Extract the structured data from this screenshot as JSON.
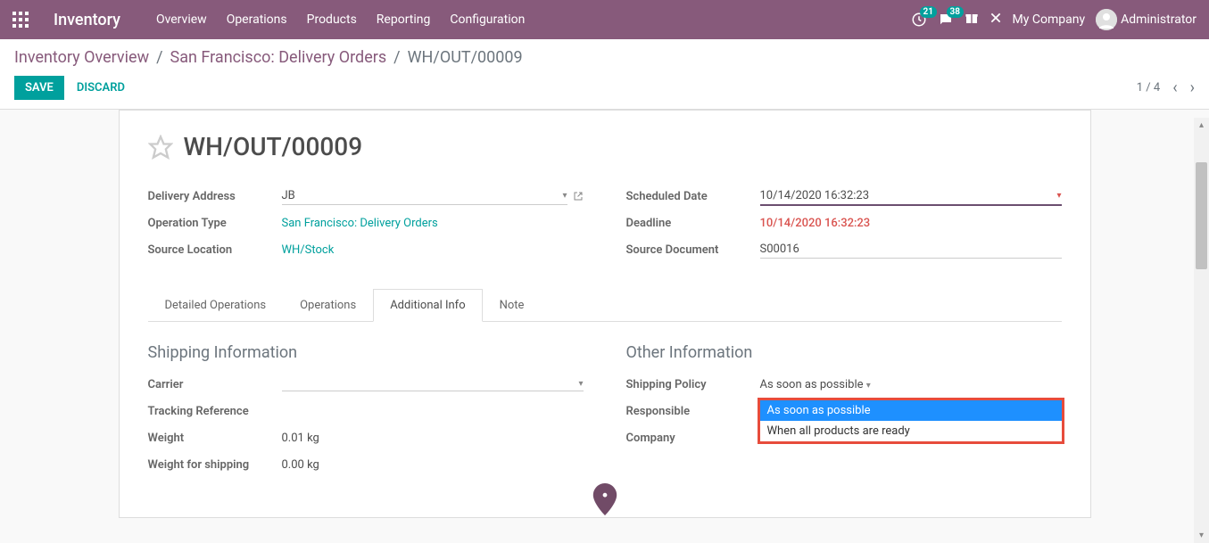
{
  "navbar": {
    "brand": "Inventory",
    "links": [
      "Overview",
      "Operations",
      "Products",
      "Reporting",
      "Configuration"
    ],
    "activity_count": "21",
    "messages_count": "38",
    "company": "My Company",
    "user": "Administrator"
  },
  "breadcrumb": {
    "items": [
      "Inventory Overview",
      "San Francisco: Delivery Orders"
    ],
    "current": "WH/OUT/00009"
  },
  "actions": {
    "save": "SAVE",
    "discard": "DISCARD",
    "pager": "1 / 4"
  },
  "record": {
    "title": "WH/OUT/00009",
    "left": {
      "delivery_address_label": "Delivery Address",
      "delivery_address": "JB",
      "operation_type_label": "Operation Type",
      "operation_type": "San Francisco: Delivery Orders",
      "source_location_label": "Source Location",
      "source_location": "WH/Stock"
    },
    "right": {
      "scheduled_date_label": "Scheduled Date",
      "scheduled_date": "10/14/2020 16:32:23",
      "deadline_label": "Deadline",
      "deadline": "10/14/2020 16:32:23",
      "source_document_label": "Source Document",
      "source_document": "S00016"
    }
  },
  "tabs": [
    "Detailed Operations",
    "Operations",
    "Additional Info",
    "Note"
  ],
  "active_tab": 2,
  "shipping_info": {
    "title": "Shipping Information",
    "carrier_label": "Carrier",
    "carrier": "",
    "tracking_ref_label": "Tracking Reference",
    "tracking_ref": "",
    "weight_label": "Weight",
    "weight": "0.01 kg",
    "weight_shipping_label": "Weight for shipping",
    "weight_shipping": "0.00 kg"
  },
  "other_info": {
    "title": "Other Information",
    "shipping_policy_label": "Shipping Policy",
    "shipping_policy": "As soon as possible",
    "responsible_label": "Responsible",
    "company_label": "Company",
    "dropdown_options": [
      "As soon as possible",
      "When all products are ready"
    ]
  }
}
